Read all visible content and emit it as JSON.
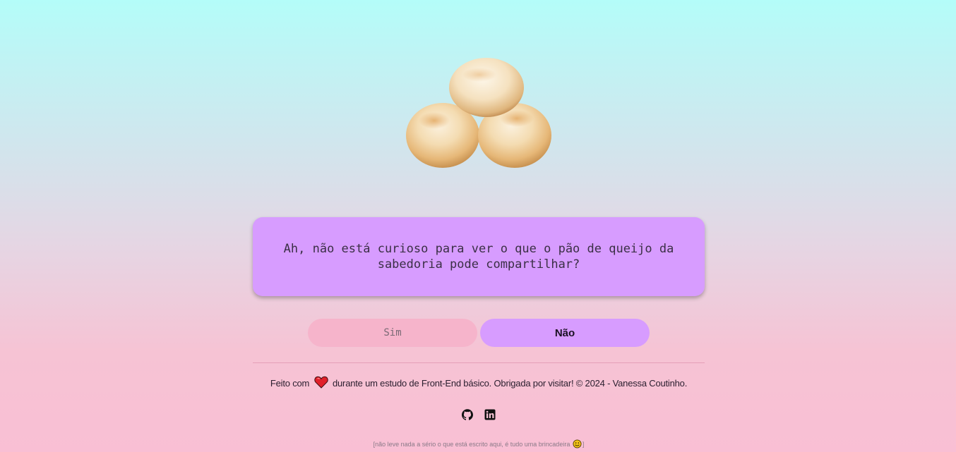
{
  "hero": {
    "image_name": "pao-de-queijo"
  },
  "question": {
    "text": "Ah, não está curioso para ver o que o pão de queijo da sabedoria pode compartilhar?"
  },
  "buttons": {
    "yes_label": "Sim",
    "no_label": "Não"
  },
  "footer": {
    "text_before": "Feito com",
    "heart_icon": "heart-icon",
    "text_after": "durante um estudo de Front-End básico. Obrigada por visitar! © 2024 - Vanessa Coutinho.",
    "social": [
      "github-icon",
      "linkedin-icon"
    ]
  },
  "disclaimer": {
    "text_before": "[não leve nada a sério o que está escrito aqui, é tudo uma brincadeira",
    "text_after": "]"
  },
  "colors": {
    "card": "#d79cff",
    "button_yes": "#f6b4cb",
    "button_no": "#d79cff",
    "heart": "#e0202a"
  }
}
